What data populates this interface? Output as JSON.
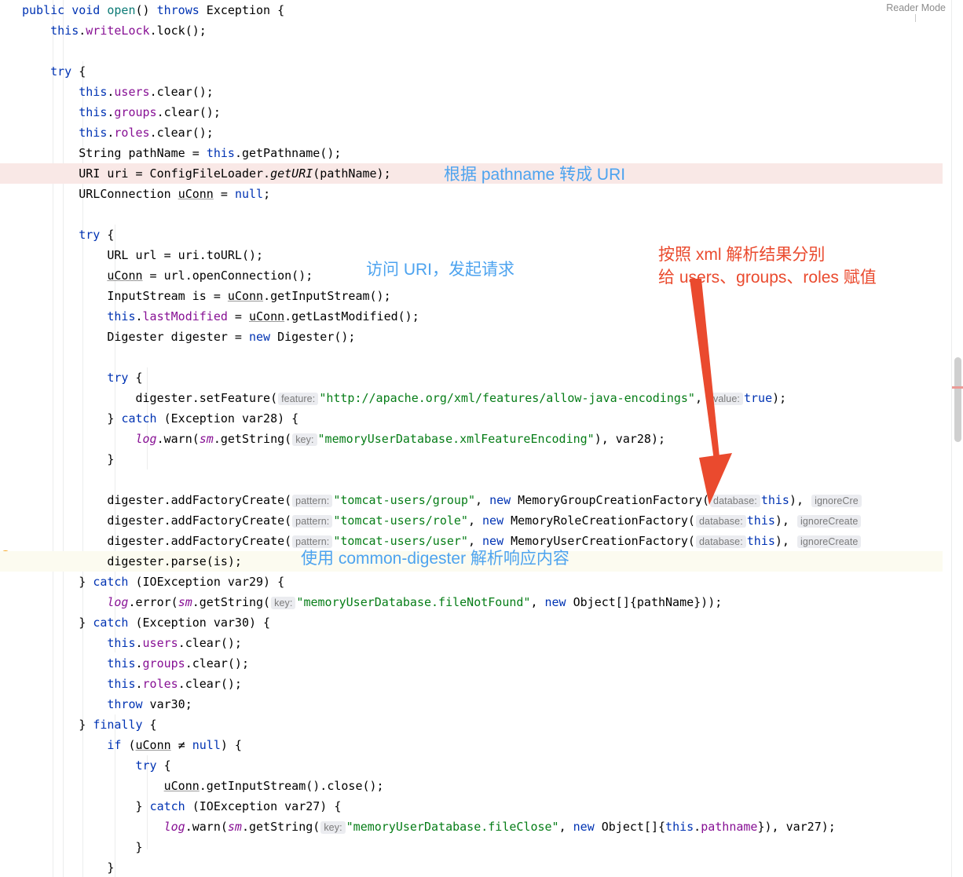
{
  "editor": {
    "reader_mode_label": "Reader Mode",
    "gutter_icon": "lightbulb-icon",
    "colors": {
      "keyword": "#0033b3",
      "string": "#067d17",
      "field": "#871094",
      "hint_bg": "#ebecf0",
      "error_line_bg": "#f9e8e6",
      "caret_line_bg": "#fcfbf0",
      "annotation_blue": "#4da3ef",
      "annotation_red": "#ea4a2e",
      "scrollbar_error_marker": "#eb9a96"
    }
  },
  "annotations": [
    {
      "id": "anno-uri",
      "text": "根据 pathname 转成 URI",
      "color": "blue"
    },
    {
      "id": "anno-req",
      "text": "访问 URI，发起请求",
      "color": "blue"
    },
    {
      "id": "anno-assign",
      "text": "按照 xml 解析结果分别\n给 users、groups、roles 赋值",
      "color": "red"
    },
    {
      "id": "anno-digest",
      "text": "使用 common-digester 解析响应内容",
      "color": "blue"
    }
  ],
  "code": {
    "language": "java",
    "lines": [
      {
        "n": 1,
        "state": "normal",
        "text": "public void open() throws Exception {"
      },
      {
        "n": 2,
        "state": "normal",
        "text": "    this.writeLock.lock();"
      },
      {
        "n": 3,
        "state": "normal",
        "text": ""
      },
      {
        "n": 4,
        "state": "normal",
        "text": "    try {"
      },
      {
        "n": 5,
        "state": "normal",
        "text": "        this.users.clear();"
      },
      {
        "n": 6,
        "state": "normal",
        "text": "        this.groups.clear();"
      },
      {
        "n": 7,
        "state": "normal",
        "text": "        this.roles.clear();"
      },
      {
        "n": 8,
        "state": "normal",
        "text": "        String pathName = this.getPathname();"
      },
      {
        "n": 9,
        "state": "error",
        "text": "        URI uri = ConfigFileLoader.getURI(pathName);"
      },
      {
        "n": 10,
        "state": "normal",
        "text": "        URLConnection uConn = null;"
      },
      {
        "n": 11,
        "state": "normal",
        "text": ""
      },
      {
        "n": 12,
        "state": "normal",
        "text": "        try {"
      },
      {
        "n": 13,
        "state": "normal",
        "text": "            URL url = uri.toURL();"
      },
      {
        "n": 14,
        "state": "normal",
        "text": "            uConn = url.openConnection();"
      },
      {
        "n": 15,
        "state": "normal",
        "text": "            InputStream is = uConn.getInputStream();"
      },
      {
        "n": 16,
        "state": "normal",
        "text": "            this.lastModified = uConn.getLastModified();"
      },
      {
        "n": 17,
        "state": "normal",
        "text": "            Digester digester = new Digester();"
      },
      {
        "n": 18,
        "state": "normal",
        "text": ""
      },
      {
        "n": 19,
        "state": "normal",
        "text": "            try {"
      },
      {
        "n": 20,
        "state": "normal",
        "text": "                digester.setFeature( feature: \"http://apache.org/xml/features/allow-java-encodings\",  value: true);"
      },
      {
        "n": 21,
        "state": "normal",
        "text": "            } catch (Exception var28) {"
      },
      {
        "n": 22,
        "state": "normal",
        "text": "                log.warn(sm.getString( key: \"memoryUserDatabase.xmlFeatureEncoding\"), var28);"
      },
      {
        "n": 23,
        "state": "normal",
        "text": "            }"
      },
      {
        "n": 24,
        "state": "normal",
        "text": ""
      },
      {
        "n": 25,
        "state": "normal",
        "text": "            digester.addFactoryCreate( pattern: \"tomcat-users/group\", new MemoryGroupCreationFactory( database: this),  ignoreCre"
      },
      {
        "n": 26,
        "state": "normal",
        "text": "            digester.addFactoryCreate( pattern: \"tomcat-users/role\", new MemoryRoleCreationFactory( database: this),  ignoreCreate"
      },
      {
        "n": 27,
        "state": "normal",
        "text": "            digester.addFactoryCreate( pattern: \"tomcat-users/user\", new MemoryUserCreationFactory( database: this),  ignoreCreate"
      },
      {
        "n": 28,
        "state": "caret",
        "text": "            digester.parse(is);"
      },
      {
        "n": 29,
        "state": "normal",
        "text": "        } catch (IOException var29) {"
      },
      {
        "n": 30,
        "state": "normal",
        "text": "            log.error(sm.getString( key: \"memoryUserDatabase.fileNotFound\", new Object[]{pathName}));"
      },
      {
        "n": 31,
        "state": "normal",
        "text": "        } catch (Exception var30) {"
      },
      {
        "n": 32,
        "state": "normal",
        "text": "            this.users.clear();"
      },
      {
        "n": 33,
        "state": "normal",
        "text": "            this.groups.clear();"
      },
      {
        "n": 34,
        "state": "normal",
        "text": "            this.roles.clear();"
      },
      {
        "n": 35,
        "state": "normal",
        "text": "            throw var30;"
      },
      {
        "n": 36,
        "state": "normal",
        "text": "        } finally {"
      },
      {
        "n": 37,
        "state": "normal",
        "text": "            if (uConn ≠ null) {"
      },
      {
        "n": 38,
        "state": "normal",
        "text": "                try {"
      },
      {
        "n": 39,
        "state": "normal",
        "text": "                    uConn.getInputStream().close();"
      },
      {
        "n": 40,
        "state": "normal",
        "text": "                } catch (IOException var27) {"
      },
      {
        "n": 41,
        "state": "normal",
        "text": "                    log.warn(sm.getString( key: \"memoryUserDatabase.fileClose\", new Object[]{this.pathname}), var27);"
      },
      {
        "n": 42,
        "state": "normal",
        "text": "                }"
      },
      {
        "n": 43,
        "state": "normal",
        "text": "            }"
      }
    ]
  }
}
